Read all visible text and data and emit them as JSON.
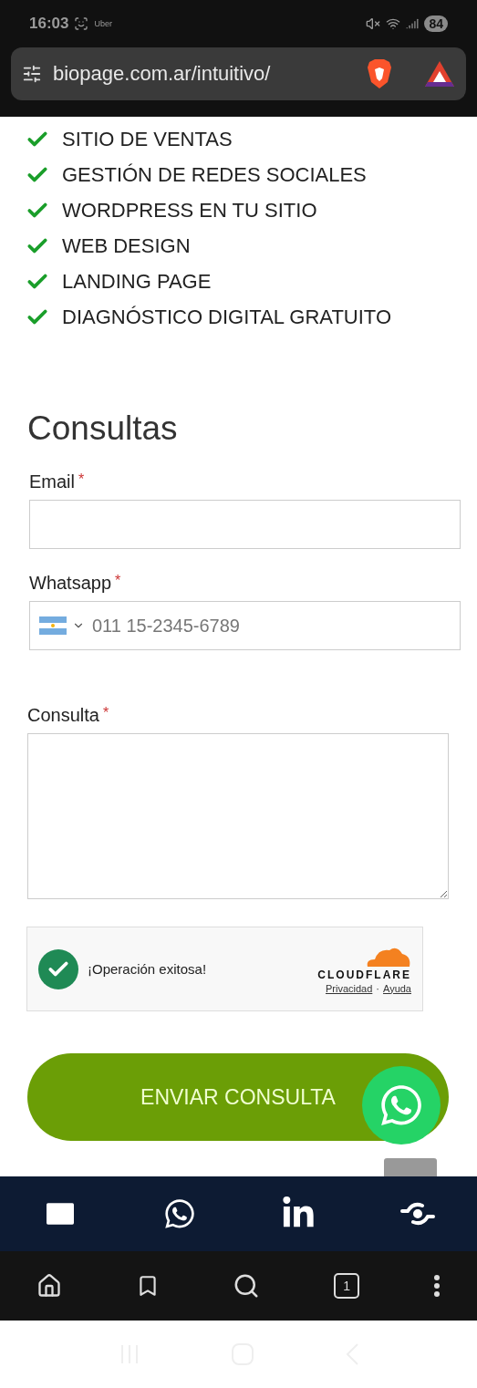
{
  "status_bar": {
    "time": "16:03",
    "app_label": "Uber",
    "battery": "84"
  },
  "address_bar": {
    "url": "biopage.com.ar/intuitivo/"
  },
  "services": [
    {
      "label": "SITIO DE VENTAS"
    },
    {
      "label": "GESTIÓN DE REDES SOCIALES"
    },
    {
      "label": "WORDPRESS EN TU SITIO"
    },
    {
      "label": "WEB DESIGN"
    },
    {
      "label": "LANDING PAGE"
    },
    {
      "label": "DIAGNÓSTICO DIGITAL GRATUITO"
    }
  ],
  "form": {
    "title": "Consultas",
    "fields": [
      {
        "kind": "text",
        "label": "Email",
        "required_mark": "*"
      },
      {
        "kind": "phone",
        "label": "Whatsapp",
        "required_mark": "*",
        "placeholder": "011 15-2345-6789"
      },
      {
        "kind": "textarea",
        "label": "Consulta",
        "required_mark": "*"
      }
    ],
    "captcha": {
      "message": "¡Operación exitosa!",
      "brand": "CLOUDFLARE",
      "links": [
        "Privacidad",
        "Ayuda"
      ],
      "separator": "·"
    },
    "submit": "ENVIAR CONSULTA"
  },
  "browser_toolbar": {
    "tab_count": "1"
  }
}
